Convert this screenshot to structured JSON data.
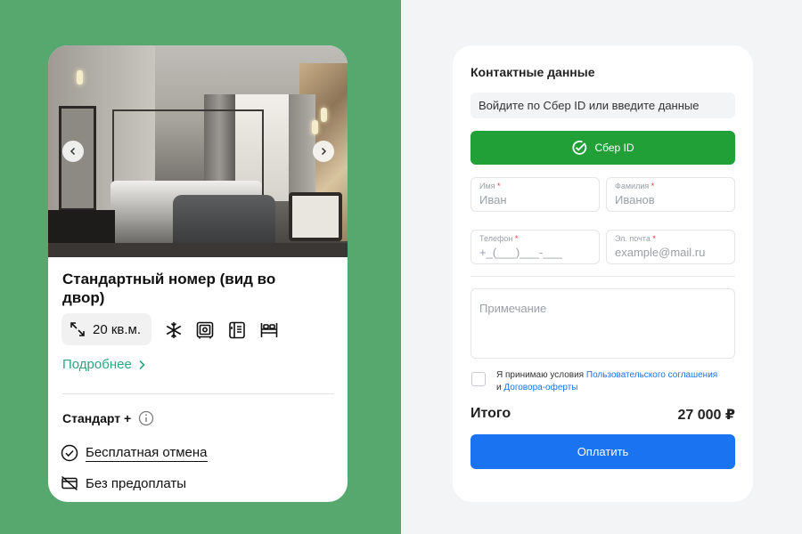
{
  "room": {
    "title": "Стандартный номер (вид во двор)",
    "area": "20 кв.м.",
    "amenities": [
      "snowflake-icon",
      "safe-icon",
      "fridge-icon",
      "bed-icon"
    ],
    "more_link": "Подробнее",
    "tariff": "Стандарт +",
    "features": [
      {
        "label": "Бесплатная отмена",
        "icon": "check-circle-icon"
      },
      {
        "label": "Без предоплаты",
        "icon": "no-card-icon"
      }
    ]
  },
  "form": {
    "title": "Контактные данные",
    "hint": "Войдите по Сбер ID или введите данные",
    "sber_button": "Сбер ID",
    "fields": {
      "first_name": {
        "label": "Имя",
        "placeholder": "Иван"
      },
      "last_name": {
        "label": "Фамилия",
        "placeholder": "Иванов"
      },
      "phone": {
        "label": "Телефон",
        "placeholder": "+_(___)___-___"
      },
      "email": {
        "label": "Эл. почта",
        "placeholder": "example@mail.ru"
      }
    },
    "required_mark": "*",
    "note_placeholder": "Примечание",
    "agreement": {
      "prefix": "Я принимаю условия",
      "link1": "Пользовательского соглашения",
      "middle": "и",
      "link2": "Договора-оферты"
    },
    "total_label": "Итого",
    "total_value": "27 000 ₽",
    "pay_button": "Оплатить"
  },
  "colors": {
    "left_background": "#56a86f",
    "sber_green": "#21a038",
    "pay_blue": "#1a73f0",
    "link_green": "#2aa77e",
    "link_blue": "#1a73e8"
  }
}
